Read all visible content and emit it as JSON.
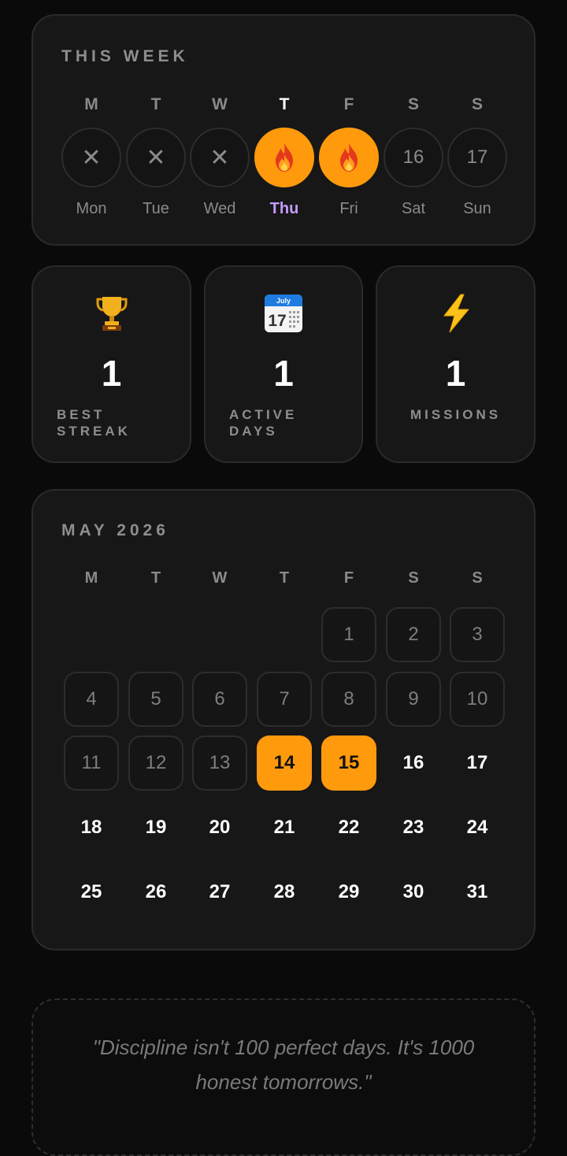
{
  "week": {
    "title": "THIS WEEK",
    "days": [
      {
        "letter": "M",
        "name": "Mon",
        "state": "missed",
        "symbol": "✕",
        "today": false
      },
      {
        "letter": "T",
        "name": "Tue",
        "state": "missed",
        "symbol": "✕",
        "today": false
      },
      {
        "letter": "W",
        "name": "Wed",
        "state": "missed",
        "symbol": "✕",
        "today": false
      },
      {
        "letter": "T",
        "name": "Thu",
        "state": "done",
        "symbol": "fire-icon",
        "today": true
      },
      {
        "letter": "F",
        "name": "Fri",
        "state": "done",
        "symbol": "fire-icon",
        "today": false
      },
      {
        "letter": "S",
        "name": "Sat",
        "state": "upcoming",
        "symbol": "16",
        "today": false
      },
      {
        "letter": "S",
        "name": "Sun",
        "state": "upcoming",
        "symbol": "17",
        "today": false
      }
    ]
  },
  "stats": {
    "best_streak": {
      "icon": "trophy-icon",
      "value": "1",
      "label": "BEST\nSTREAK"
    },
    "active_days": {
      "icon": "calendar-icon",
      "value": "1",
      "label": "ACTIVE\nDAYS",
      "calendar_month": "July",
      "calendar_day": "17"
    },
    "missions": {
      "icon": "lightning-icon",
      "value": "1",
      "label": "MISSIONS"
    }
  },
  "calendar": {
    "title": "MAY 2026",
    "weekdays": [
      "M",
      "T",
      "W",
      "T",
      "F",
      "S",
      "S"
    ],
    "start_weekday_index": 4,
    "days_in_month": 31,
    "past_days": [
      1,
      2,
      3,
      4,
      5,
      6,
      7,
      8,
      9,
      10,
      11,
      12,
      13
    ],
    "active_days": [
      14,
      15
    ],
    "future_days": [
      16,
      17,
      18,
      19,
      20,
      21,
      22,
      23,
      24,
      25,
      26,
      27,
      28,
      29,
      30,
      31
    ]
  },
  "quote": {
    "text": "\"Discipline isn't 100 perfect days. It's 1000 honest tomorrows.\""
  },
  "colors": {
    "accent": "#ff9a0d",
    "today": "#c59cff",
    "card": "#171717",
    "background": "#0a0a0a"
  }
}
